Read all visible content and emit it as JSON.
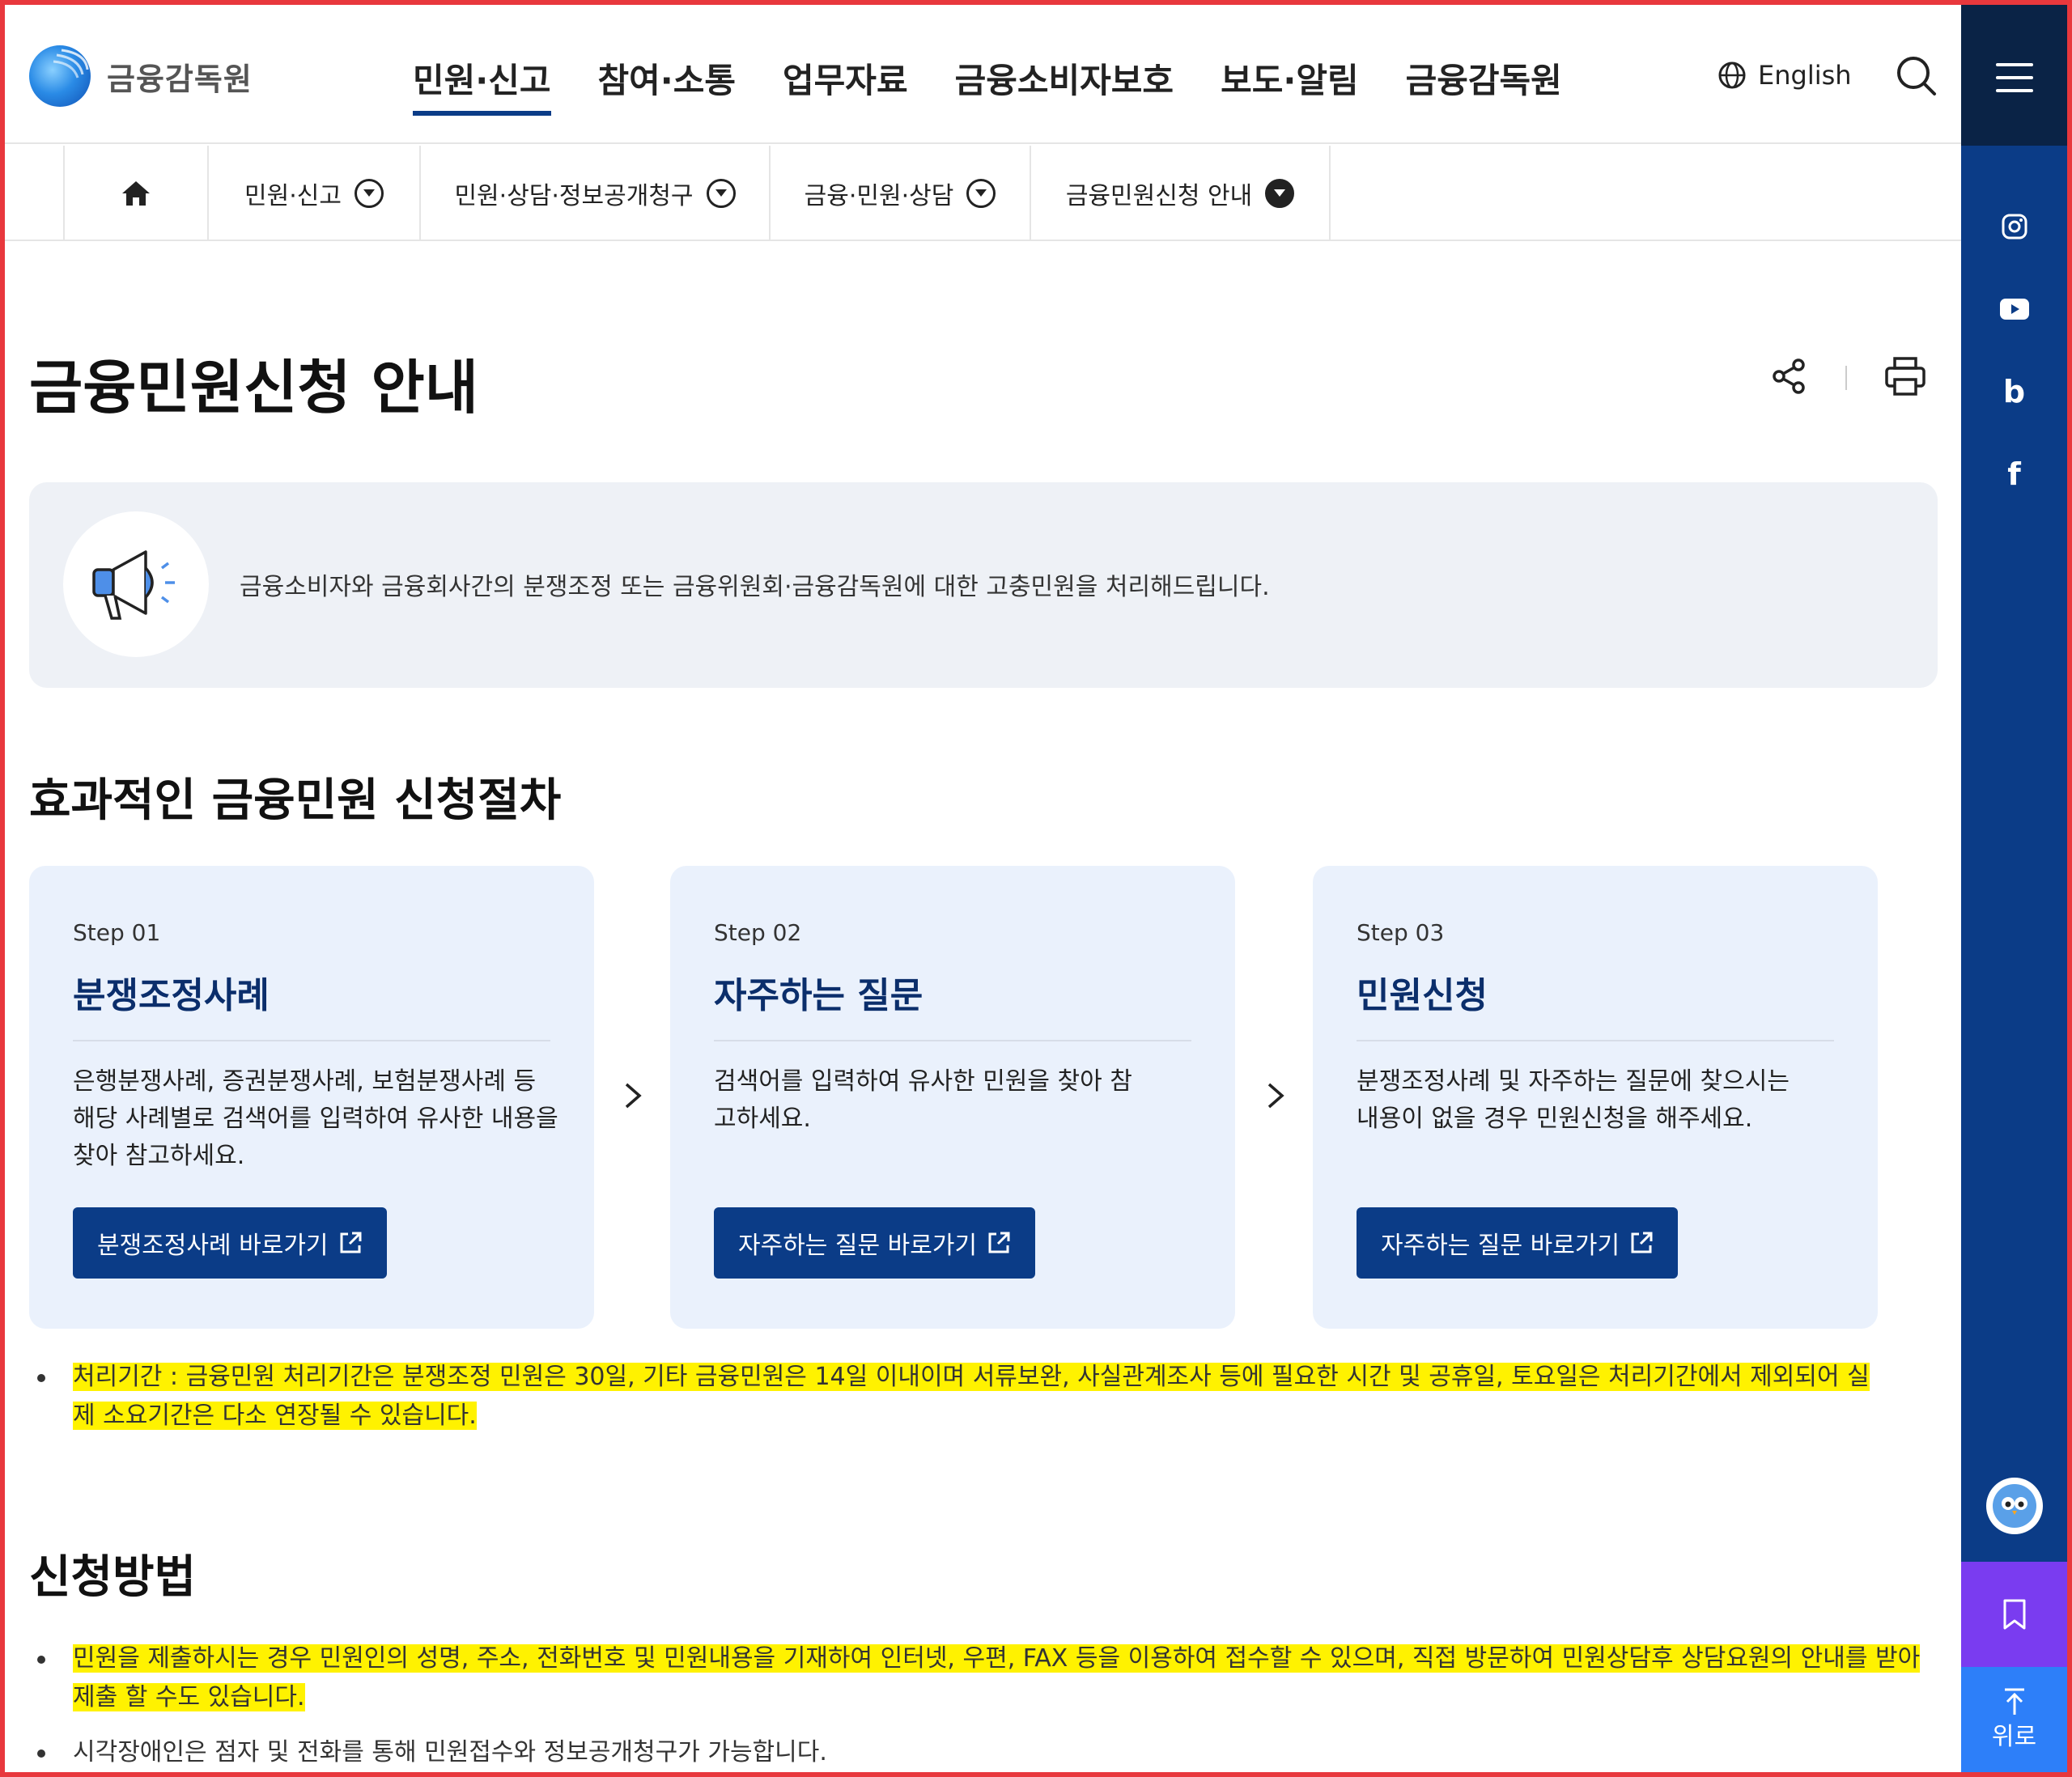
{
  "header": {
    "logo_text": "금융감독원",
    "nav": [
      "민원·신고",
      "참여·소통",
      "업무자료",
      "금융소비자보호",
      "보도·알림",
      "금융감독원"
    ],
    "active_nav": "민원·신고",
    "lang_label": "English"
  },
  "breadcrumb": {
    "items": [
      "민원·신고",
      "민원·상담·정보공개청구",
      "금융·민원·상담",
      "금융민원신청 안내"
    ]
  },
  "page": {
    "title": "금융민원신청 안내",
    "intro": "금융소비자와 금융회사간의 분쟁조정 또는 금융위원회·금융감독원에 대한 고충민원을 처리해드립니다."
  },
  "procedure": {
    "heading": "효과적인 금융민원 신청절차",
    "steps": [
      {
        "step": "Step 01",
        "title": "분쟁조정사례",
        "desc": "은행분쟁사례, 증권분쟁사례, 보험분쟁사례 등 해당 사례별로 검색어를 입력하여 유사한 내용을 찾아 참고하세요.",
        "button": "분쟁조정사례 바로가기"
      },
      {
        "step": "Step 02",
        "title": "자주하는 질문",
        "desc": "검색어를 입력하여 유사한 민원을 찾아 참고하세요.",
        "button": "자주하는 질문 바로가기"
      },
      {
        "step": "Step 03",
        "title": "민원신청",
        "desc": "분쟁조정사례 및 자주하는 질문에 찾으시는 내용이 없을 경우 민원신청을 해주세요.",
        "button": "자주하는 질문 바로가기"
      }
    ],
    "note": "처리기간 : 금융민원 처리기간은 분쟁조정 민원은 30일, 기타 금융민원은 14일 이내이며 서류보완, 사실관계조사 등에 필요한 시간 및 공휴일, 토요일은 처리기간에서 제외되어 실제 소요기간은 다소 연장될 수 있습니다."
  },
  "method": {
    "heading": "신청방법",
    "items": [
      "민원을 제출하시는 경우 민원인의 성명, 주소, 전화번호 및 민원내용을 기재하여 인터넷, 우편, FAX 등을 이용하여 접수할 수 있으며, 직접 방문하여 민원상담후 상담요원의 안내를 받아 제출 할 수도 있습니다.",
      "시각장애인은 점자 및 전화를 통해 민원접수와 정보공개청구가 가능합니다."
    ]
  },
  "sidebar": {
    "sns": [
      "instagram-icon",
      "youtube-icon",
      "blog-icon",
      "facebook-icon"
    ],
    "blog_glyph": "b",
    "facebook_glyph": "f",
    "top_label": "위로"
  },
  "colors": {
    "navy": "#0b3c87",
    "dark_navy": "#0a2346",
    "purple": "#7a3cf0",
    "blue": "#2d7ff9",
    "highlight": "#fff200",
    "card_bg": "#eaf1fc"
  }
}
